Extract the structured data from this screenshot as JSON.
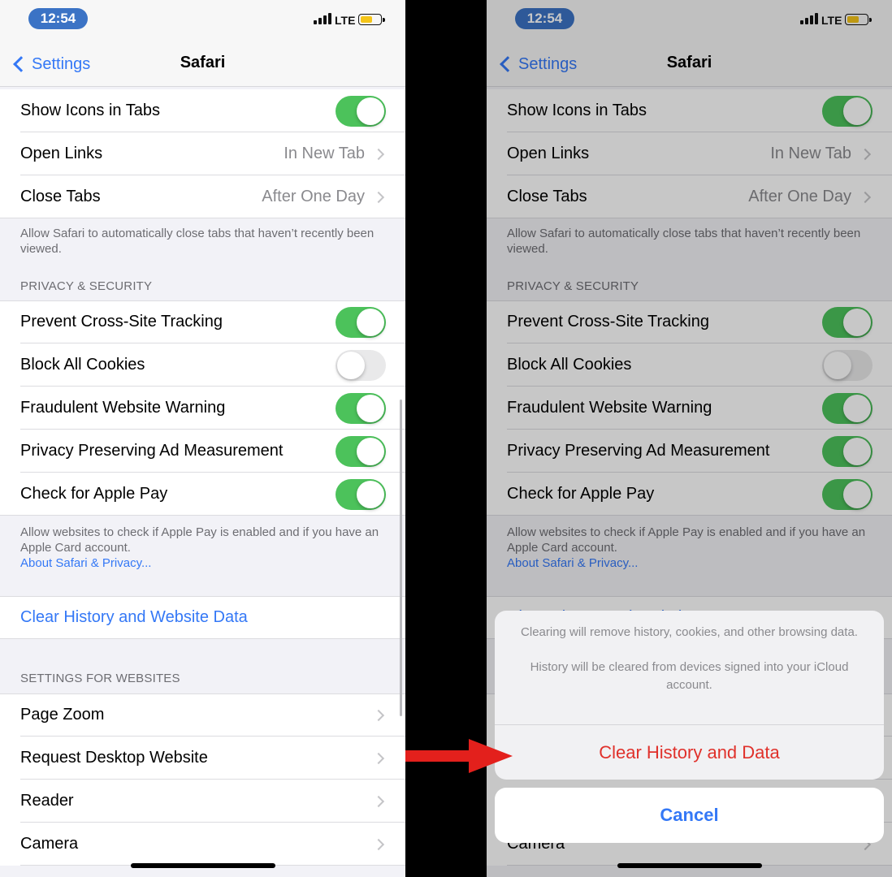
{
  "status_bar": {
    "time": "12:54",
    "network": "LTE"
  },
  "nav": {
    "back_label": "Settings",
    "title": "Safari"
  },
  "tabs_group": {
    "show_icons": {
      "label": "Show Icons in Tabs",
      "state": "on"
    },
    "open_links": {
      "label": "Open Links",
      "value": "In New Tab"
    },
    "close_tabs": {
      "label": "Close Tabs",
      "value": "After One Day"
    },
    "footer": "Allow Safari to automatically close tabs that haven’t recently been viewed."
  },
  "privacy": {
    "header": "PRIVACY & SECURITY",
    "items": [
      {
        "label": "Prevent Cross-Site Tracking",
        "state": "on"
      },
      {
        "label": "Block All Cookies",
        "state": "off"
      },
      {
        "label": "Fraudulent Website Warning",
        "state": "on"
      },
      {
        "label": "Privacy Preserving Ad Measurement",
        "state": "on"
      },
      {
        "label": "Check for Apple Pay",
        "state": "on"
      }
    ],
    "footer": "Allow websites to check if Apple Pay is enabled and if you have an Apple Card account.",
    "footer_link": "About Safari & Privacy..."
  },
  "clear_history": {
    "label": "Clear History and Website Data"
  },
  "websites": {
    "header": "SETTINGS FOR WEBSITES",
    "items": [
      {
        "label": "Page Zoom"
      },
      {
        "label": "Request Desktop Website"
      },
      {
        "label": "Reader"
      },
      {
        "label": "Camera"
      }
    ]
  },
  "action_sheet": {
    "message_1": "Clearing will remove history, cookies, and other browsing data.",
    "message_2": "History will be cleared from devices signed into your iCloud account.",
    "destructive_label": "Clear History and Data",
    "cancel_label": "Cancel"
  },
  "colors": {
    "accent": "#3478f6",
    "toggle_on": "#4cc25b",
    "destructive": "#e0312b",
    "time_pill": "#3b73c5",
    "annotation_arrow": "#e3201c"
  }
}
